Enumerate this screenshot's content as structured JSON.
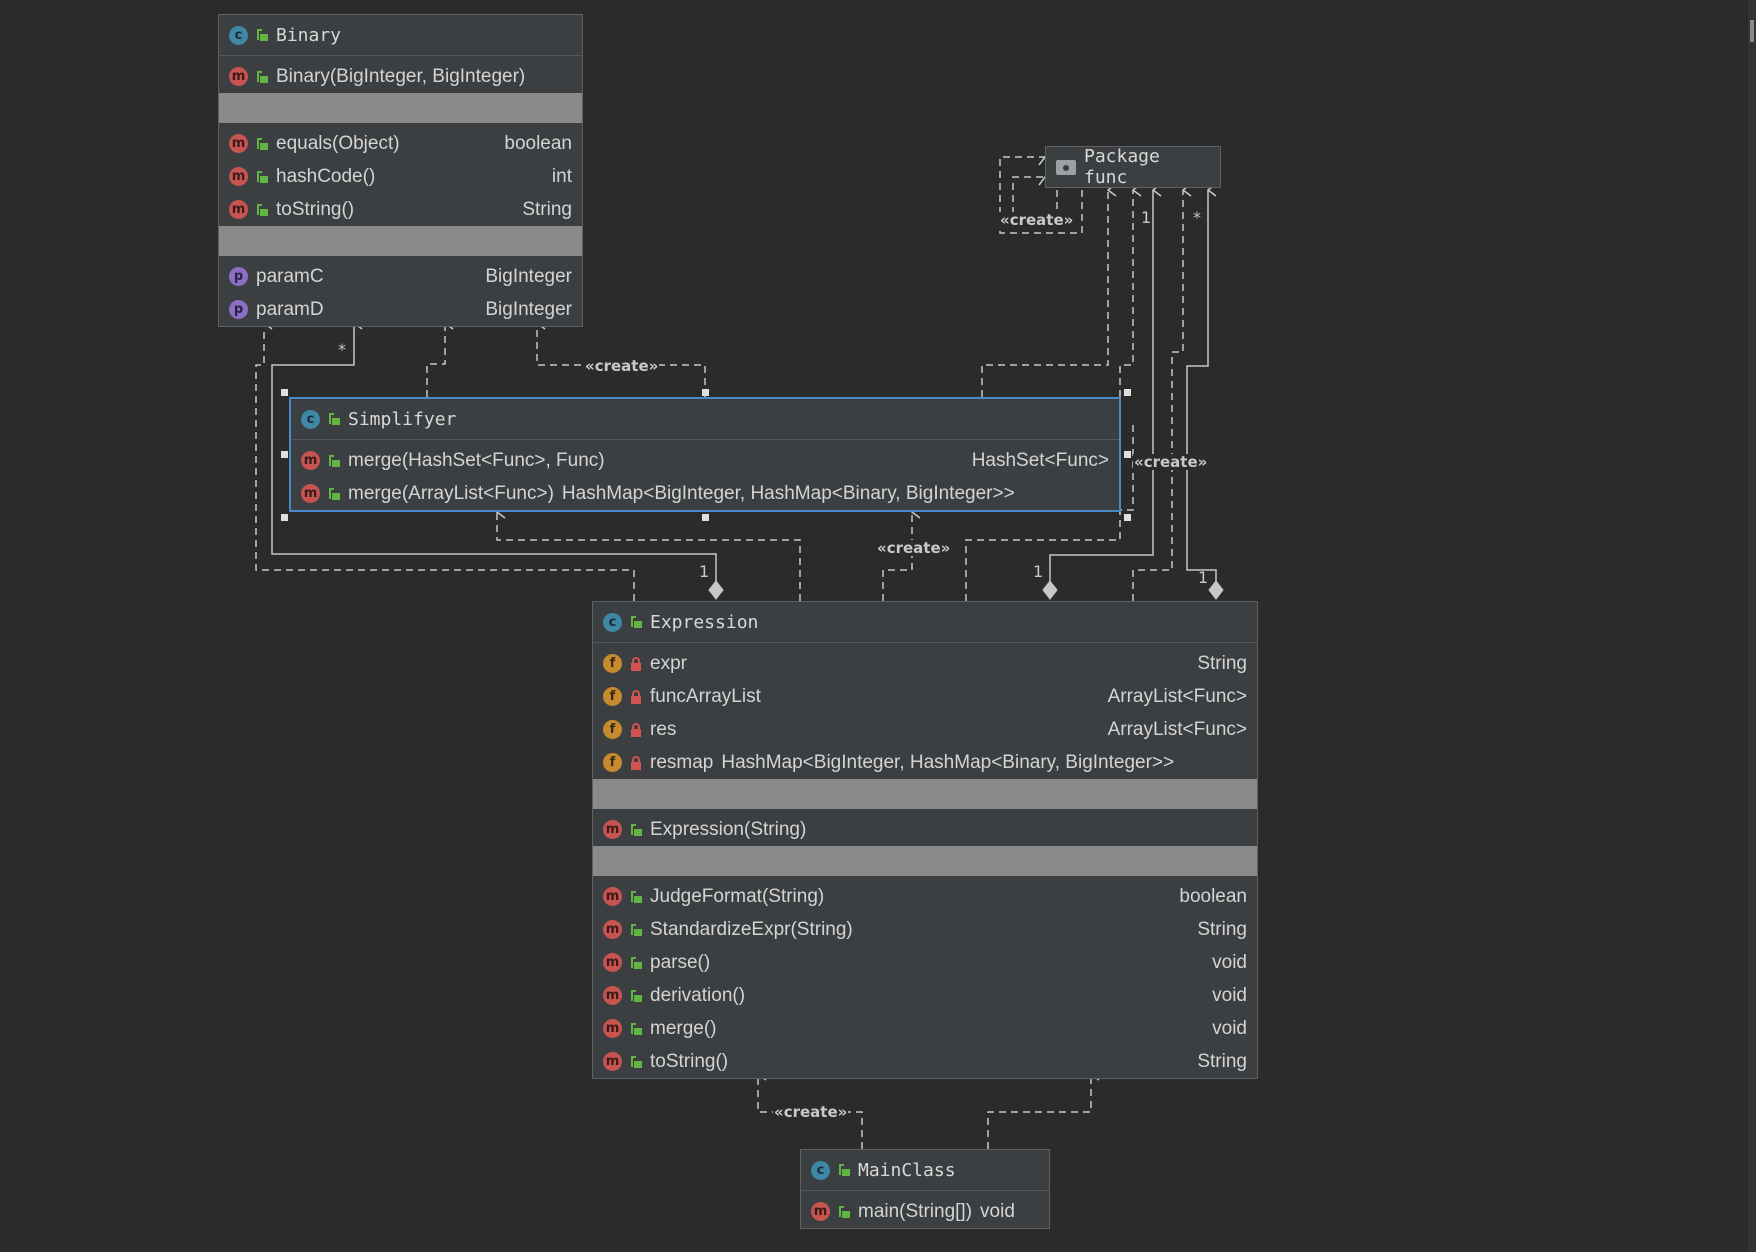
{
  "nodes": {
    "binary": {
      "title": "Binary",
      "constructors": [
        {
          "name": "Binary(BigInteger, BigInteger)",
          "type": ""
        }
      ],
      "methods": [
        {
          "name": "equals(Object)",
          "type": "boolean"
        },
        {
          "name": "hashCode()",
          "type": "int"
        },
        {
          "name": "toString()",
          "type": "String"
        }
      ],
      "properties": [
        {
          "name": "paramC",
          "type": "BigInteger"
        },
        {
          "name": "paramD",
          "type": "BigInteger"
        }
      ]
    },
    "package": {
      "title": "Package func"
    },
    "simplifyer": {
      "title": "Simplifyer",
      "methods": [
        {
          "name": "merge(HashSet<Func>, Func)",
          "type": "HashSet<Func>"
        },
        {
          "name": "merge(ArrayList<Func>)",
          "type": "HashMap<BigInteger, HashMap<Binary, BigInteger>>"
        }
      ]
    },
    "expression": {
      "title": "Expression",
      "fields": [
        {
          "name": "expr",
          "type": "String"
        },
        {
          "name": "funcArrayList",
          "type": "ArrayList<Func>"
        },
        {
          "name": "res",
          "type": "ArrayList<Func>"
        },
        {
          "name": "resmap",
          "type": "HashMap<BigInteger, HashMap<Binary, BigInteger>>"
        }
      ],
      "constructors": [
        {
          "name": "Expression(String)",
          "type": ""
        }
      ],
      "methods": [
        {
          "name": "JudgeFormat(String)",
          "type": "boolean"
        },
        {
          "name": "StandardizeExpr(String)",
          "type": "String"
        },
        {
          "name": "parse()",
          "type": "void"
        },
        {
          "name": "derivation()",
          "type": "void"
        },
        {
          "name": "merge()",
          "type": "void"
        },
        {
          "name": "toString()",
          "type": "String"
        }
      ]
    },
    "mainclass": {
      "title": "MainClass",
      "methods": [
        {
          "name": "main(String[])",
          "type": "void"
        }
      ]
    }
  },
  "labels": {
    "create": "«create»",
    "one": "1",
    "many": "*"
  },
  "colors": {
    "background": "#2b2b2b",
    "node": "#3c3f41",
    "separator": "#8a8a8a",
    "selection": "#4a88c7",
    "edge": "#c8c8c8"
  },
  "icons": {
    "class": "class-icon",
    "method": "method-icon",
    "field": "field-icon",
    "property": "property-icon",
    "package": "folder-icon"
  }
}
